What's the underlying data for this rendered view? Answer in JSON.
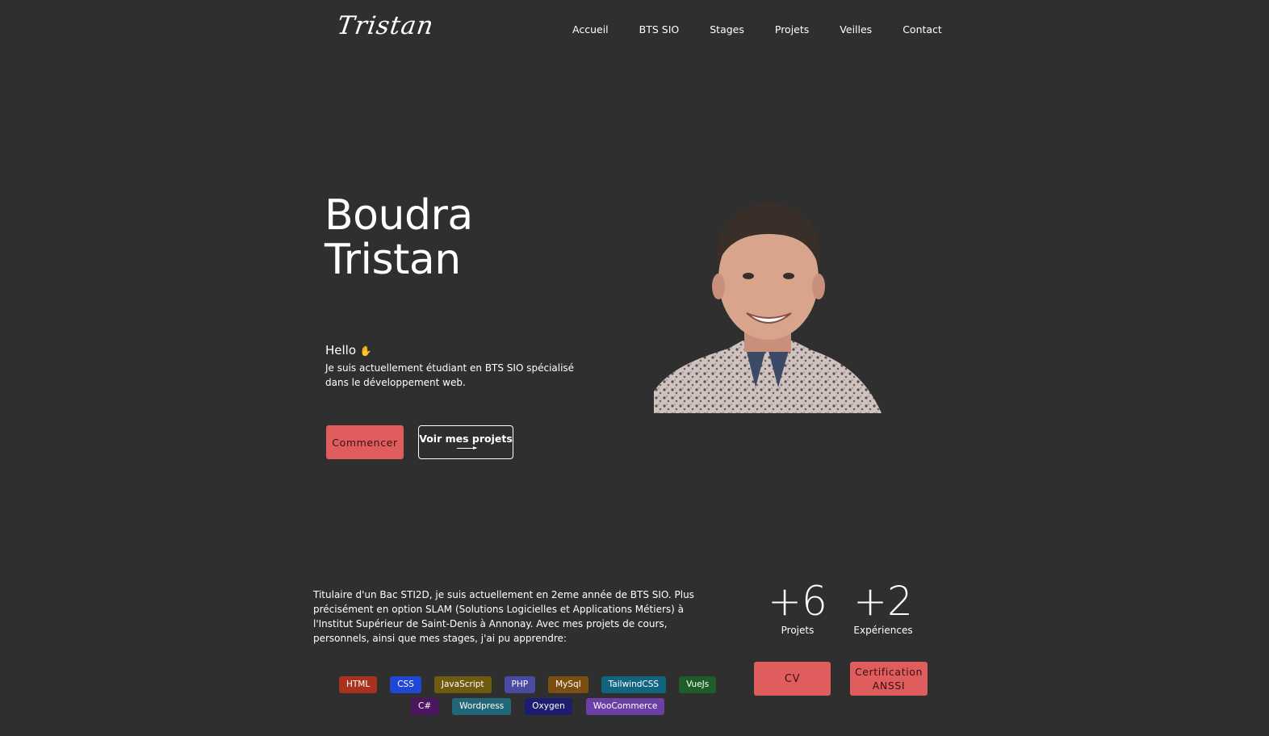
{
  "header": {
    "logo": "Tristan",
    "nav": [
      "Accueil",
      "BTS SIO",
      "Stages",
      "Projets",
      "Veilles",
      "Contact"
    ]
  },
  "hero": {
    "title_line1": "Boudra",
    "title_line2": "Tristan",
    "hello": "Hello",
    "wave_icon": "waving-hand-icon",
    "intro": "Je suis actuellement étudiant en BTS SIO spécialisé dans le développement web.",
    "btn_start": "Commencer",
    "btn_projects": "Voir mes projets"
  },
  "about": {
    "text": "Titulaire d'un Bac STI2D, je suis actuellement en 2eme année de BTS SIO. Plus précisément en option SLAM (Solutions Logicielles et Applications Métiers) à l'Institut Supérieur de Saint-Denis à Annonay. Avec mes projets de cours, personnels, ainsi que mes stages, j'ai pu apprendre:"
  },
  "stats": [
    {
      "value": "+6",
      "label": "Projets"
    },
    {
      "value": "+2",
      "label": "Expériences"
    }
  ],
  "buttons": {
    "cv": "CV",
    "cert": "Certification ANSSI"
  },
  "tags_row1": [
    {
      "label": "HTML",
      "color": "#a8321b"
    },
    {
      "label": "CSS",
      "color": "#1f47d6"
    },
    {
      "label": "JavaScript",
      "color": "#6f5a10"
    },
    {
      "label": "PHP",
      "color": "#4a4aa3"
    },
    {
      "label": "MySql",
      "color": "#7a4f10"
    },
    {
      "label": "TailwindCSS",
      "color": "#11667f"
    },
    {
      "label": "VueJs",
      "color": "#1f5d27"
    }
  ],
  "tags_row2": [
    {
      "label": "C#",
      "color": "#4c1560"
    },
    {
      "label": "Wordpress",
      "color": "#216778"
    },
    {
      "label": "Oxygen",
      "color": "#1b1e6e"
    },
    {
      "label": "WooCommerce",
      "color": "#6c3fa5"
    }
  ],
  "colors": {
    "background": "#2f2f2f",
    "accent": "#e05d5d"
  }
}
